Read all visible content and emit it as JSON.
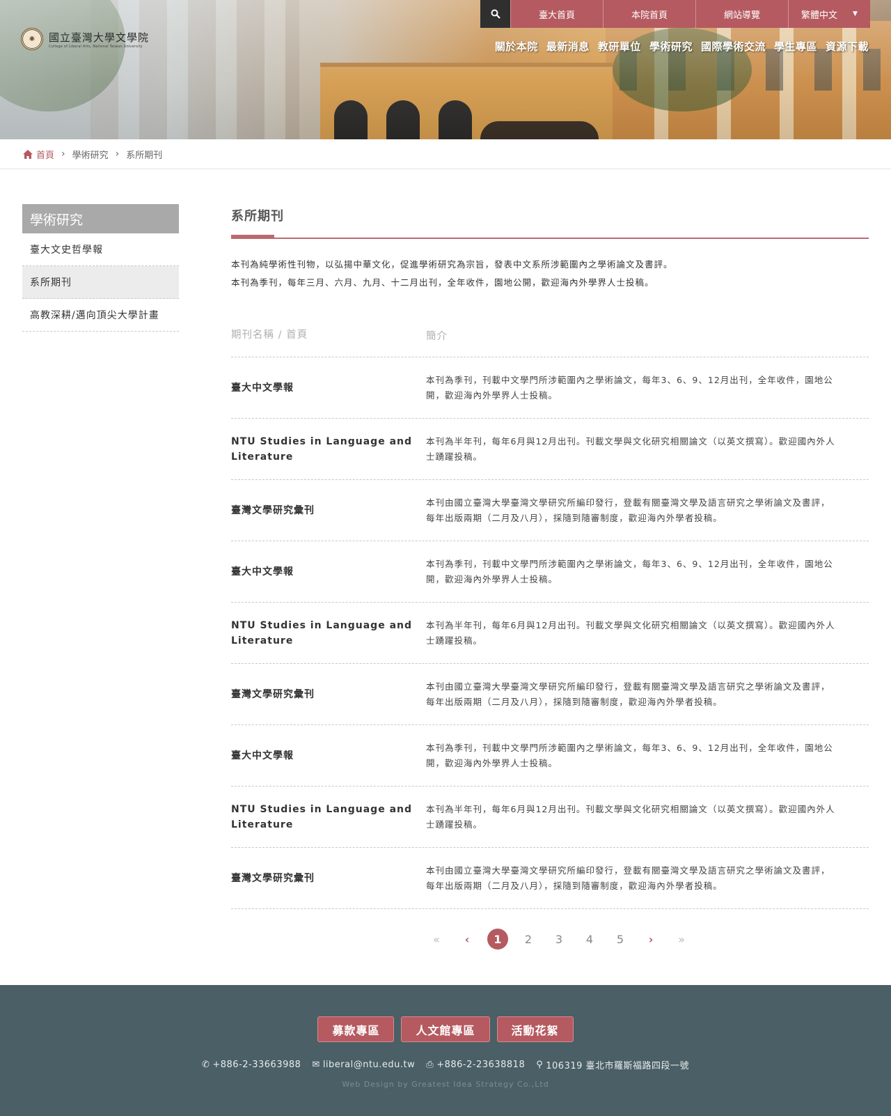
{
  "colors": {
    "accent": "#b55a60",
    "footer_bg": "#4a5f66",
    "sidebar_title_bg": "#a9a9a9"
  },
  "logo": {
    "name_zh": "國立臺灣大學文學院",
    "name_en": "College of Liberal Arts, National Taiwan University"
  },
  "topbar": {
    "search_icon": "search-icon",
    "links": [
      "臺大首頁",
      "本院首頁",
      "網站導覽"
    ],
    "language": "繁體中文"
  },
  "mainnav": [
    "關於本院",
    "最新消息",
    "教研單位",
    "學術研究",
    "國際學術交流",
    "學生專區",
    "資源下載"
  ],
  "breadcrumb": {
    "home": "首頁",
    "level1": "學術研究",
    "level2": "系所期刊"
  },
  "sidebar": {
    "title": "學術研究",
    "items": [
      {
        "label": "臺大文史哲學報",
        "active": false
      },
      {
        "label": "系所期刊",
        "active": true
      },
      {
        "label": "高教深耕/邁向頂尖大學計畫",
        "active": false
      }
    ]
  },
  "main": {
    "title": "系所期刊",
    "intro": [
      "本刊為純學術性刊物，以弘揚中華文化，促進學術研究為宗旨，發表中文系所涉範圍內之學術論文及書評。",
      "本刊為季刊，每年三月、六月、九月、十二月出刊，全年收件，園地公開，歡迎海內外學界人士投稿。"
    ],
    "table": {
      "headers": [
        "期刊名稱 / 首頁",
        "簡介"
      ],
      "rows": [
        {
          "name": "臺大中文學報",
          "desc": "本刊為季刊，刊載中文學門所涉範圍內之學術論文，每年3、6、9、12月出刊，全年收件，園地公開，歡迎海內外學界人士投稿。"
        },
        {
          "name": "NTU Studies in Language and Literature",
          "desc": "本刊為半年刊，每年6月與12月出刊。刊載文學與文化研究相關論文（以英文撰寫）。歡迎國內外人士踴躍投稿。"
        },
        {
          "name": "臺灣文學研究彙刊",
          "desc": "本刊由國立臺灣大學臺灣文學研究所編印發行，登載有關臺灣文學及語言研究之學術論文及書評，每年出版兩期（二月及八月），採隨到隨審制度，歡迎海內外學者投稿。"
        },
        {
          "name": "臺大中文學報",
          "desc": "本刊為季刊，刊載中文學門所涉範圍內之學術論文，每年3、6、9、12月出刊，全年收件，園地公開，歡迎海內外學界人士投稿。"
        },
        {
          "name": "NTU Studies in Language and Literature",
          "desc": "本刊為半年刊，每年6月與12月出刊。刊載文學與文化研究相關論文（以英文撰寫）。歡迎國內外人士踴躍投稿。"
        },
        {
          "name": "臺灣文學研究彙刊",
          "desc": "本刊由國立臺灣大學臺灣文學研究所編印發行，登載有關臺灣文學及語言研究之學術論文及書評，每年出版兩期（二月及八月），採隨到隨審制度，歡迎海內外學者投稿。"
        },
        {
          "name": "臺大中文學報",
          "desc": "本刊為季刊，刊載中文學門所涉範圍內之學術論文，每年3、6、9、12月出刊，全年收件，園地公開，歡迎海內外學界人士投稿。"
        },
        {
          "name": "NTU Studies in Language and Literature",
          "desc": "本刊為半年刊，每年6月與12月出刊。刊載文學與文化研究相關論文（以英文撰寫）。歡迎國內外人士踴躍投稿。"
        },
        {
          "name": "臺灣文學研究彙刊",
          "desc": "本刊由國立臺灣大學臺灣文學研究所編印發行，登載有關臺灣文學及語言研究之學術論文及書評，每年出版兩期（二月及八月），採隨到隨審制度，歡迎海內外學者投稿。"
        }
      ]
    }
  },
  "pagination": {
    "first": "«",
    "prev": "‹",
    "pages": [
      "1",
      "2",
      "3",
      "4",
      "5"
    ],
    "current": "1",
    "next": "›",
    "last": "»"
  },
  "footer": {
    "buttons": [
      "募款專區",
      "人文館專區",
      "活動花絮"
    ],
    "phone": "+886-2-33663988",
    "email": "liberal@ntu.edu.tw",
    "fax": "+886-2-23638818",
    "address": "106319 臺北市羅斯福路四段一號",
    "credit": "Web Design by Greatest Idea Strategy Co.,Ltd"
  }
}
